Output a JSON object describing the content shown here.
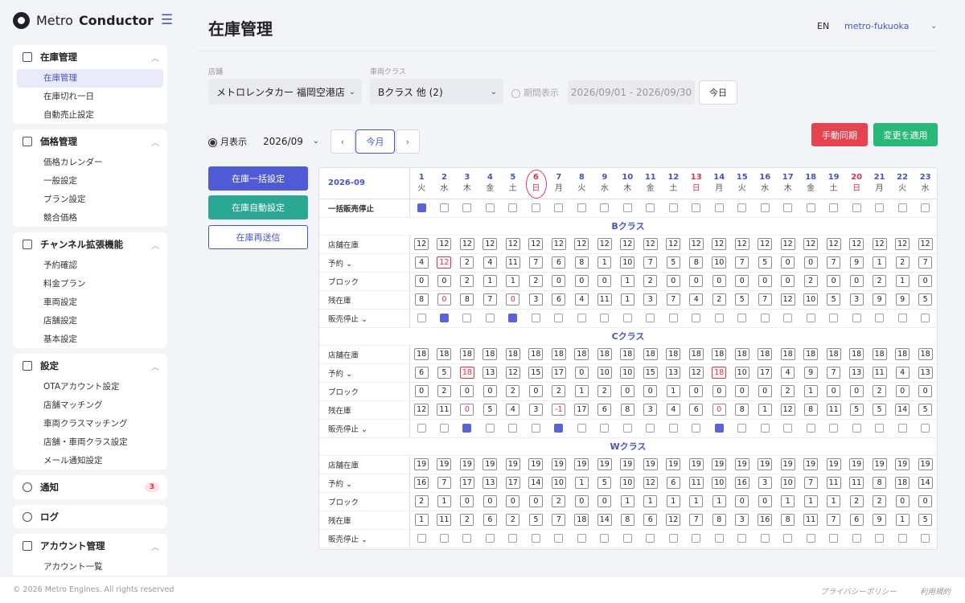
{
  "app": {
    "brand_a": "Metro",
    "brand_b": "Conductor"
  },
  "sidebar": {
    "sections": [
      {
        "title": "在庫管理",
        "items": [
          "在庫管理",
          "在庫切れ一日",
          "自動売止設定"
        ]
      },
      {
        "title": "価格管理",
        "items": [
          "価格カレンダー",
          "一般設定",
          "プラン設定",
          "競合価格"
        ]
      },
      {
        "title": "チャンネル拡張機能",
        "items": [
          "予約確認",
          "料金プラン",
          "車両設定",
          "店舗設定",
          "基本設定"
        ]
      },
      {
        "title": "設定",
        "items": [
          "OTAアカウント設定",
          "店舗マッチング",
          "車両クラスマッチング",
          "店舗・車両クラス設定",
          "メール通知設定"
        ]
      },
      {
        "title": "アカウント管理",
        "items": [
          "アカウント一覧"
        ]
      }
    ],
    "notice": {
      "title": "通知",
      "badge": "3"
    },
    "log": {
      "title": "ログ"
    }
  },
  "header": {
    "title": "在庫管理",
    "lang": "EN",
    "user": "metro-fukuoka"
  },
  "filters": {
    "store_label": "店舗",
    "store_value": "メトロレンタカー 福岡空港店",
    "class_label": "車両クラス",
    "class_value": "Bクラス 他 (2)",
    "period_label": "期間表示",
    "date_range": "2026/09/01 - 2026/09/30",
    "today_btn": "今日"
  },
  "view": {
    "monthly_label": "月表示",
    "month_value": "2026/09",
    "prev": "‹",
    "this_month": "今月",
    "next": "›"
  },
  "actions": {
    "manual_sync": "手動同期",
    "apply_changes": "変更を適用",
    "bulk_set": "在庫一括設定",
    "auto_set": "在庫自動設定",
    "resend": "在庫再送信"
  },
  "grid": {
    "month": "2026-09",
    "days": [
      {
        "d": "1",
        "w": "火"
      },
      {
        "d": "2",
        "w": "水"
      },
      {
        "d": "3",
        "w": "木"
      },
      {
        "d": "4",
        "w": "金"
      },
      {
        "d": "5",
        "w": "土"
      },
      {
        "d": "6",
        "w": "日",
        "sun": true,
        "today": true
      },
      {
        "d": "7",
        "w": "月"
      },
      {
        "d": "8",
        "w": "火"
      },
      {
        "d": "9",
        "w": "水"
      },
      {
        "d": "10",
        "w": "木"
      },
      {
        "d": "11",
        "w": "金"
      },
      {
        "d": "12",
        "w": "土"
      },
      {
        "d": "13",
        "w": "日",
        "sun": true
      },
      {
        "d": "14",
        "w": "月"
      },
      {
        "d": "15",
        "w": "火"
      },
      {
        "d": "16",
        "w": "水"
      },
      {
        "d": "17",
        "w": "木"
      },
      {
        "d": "18",
        "w": "金"
      },
      {
        "d": "19",
        "w": "土"
      },
      {
        "d": "20",
        "w": "日",
        "sun": true
      },
      {
        "d": "21",
        "w": "月"
      },
      {
        "d": "22",
        "w": "火"
      },
      {
        "d": "23",
        "w": "水"
      }
    ],
    "bulk_stop_label": "一括販売停止",
    "bulk_stop": [
      1,
      0,
      0,
      0,
      0,
      0,
      0,
      0,
      0,
      0,
      0,
      0,
      0,
      0,
      0,
      0,
      0,
      0,
      0,
      0,
      0,
      0,
      0
    ],
    "row_labels": {
      "store": "店舗在庫",
      "reserve": "予約 ⌄",
      "block": "ブロック",
      "remain": "残在庫",
      "stop": "販売停止 ⌄"
    },
    "classes": [
      {
        "name": "Bクラス",
        "store": [
          12,
          12,
          12,
          12,
          12,
          12,
          12,
          12,
          12,
          12,
          12,
          12,
          12,
          12,
          12,
          12,
          12,
          12,
          12,
          12,
          12,
          12,
          12
        ],
        "reserve": [
          4,
          12,
          2,
          4,
          11,
          7,
          6,
          8,
          1,
          10,
          7,
          5,
          8,
          10,
          7,
          5,
          0,
          0,
          7,
          9,
          1,
          2,
          7
        ],
        "reserve_flag": [
          1
        ],
        "block": [
          0,
          0,
          2,
          1,
          1,
          2,
          0,
          0,
          0,
          1,
          2,
          0,
          0,
          0,
          0,
          0,
          0,
          2,
          0,
          0,
          2,
          1,
          0
        ],
        "remain": [
          8,
          0,
          8,
          7,
          0,
          3,
          6,
          4,
          11,
          1,
          3,
          7,
          4,
          2,
          5,
          7,
          12,
          10,
          5,
          3,
          9,
          9,
          5
        ],
        "stop": [
          0,
          1,
          0,
          0,
          1,
          0,
          0,
          0,
          0,
          0,
          0,
          0,
          0,
          0,
          0,
          0,
          0,
          0,
          0,
          0,
          0,
          0,
          0
        ]
      },
      {
        "name": "Cクラス",
        "store": [
          18,
          18,
          18,
          18,
          18,
          18,
          18,
          18,
          18,
          18,
          18,
          18,
          18,
          18,
          18,
          18,
          18,
          18,
          18,
          18,
          18,
          18,
          18
        ],
        "reserve": [
          6,
          5,
          18,
          13,
          12,
          15,
          17,
          0,
          10,
          10,
          15,
          13,
          12,
          18,
          10,
          17,
          4,
          9,
          7,
          13,
          11,
          4,
          13
        ],
        "reserve_flag": [
          2,
          13
        ],
        "block": [
          0,
          2,
          0,
          0,
          2,
          0,
          2,
          1,
          2,
          0,
          0,
          1,
          0,
          0,
          0,
          0,
          2,
          1,
          0,
          0,
          2,
          0,
          0
        ],
        "remain": [
          12,
          11,
          0,
          5,
          4,
          3,
          -1,
          17,
          6,
          8,
          3,
          4,
          6,
          0,
          8,
          1,
          12,
          8,
          11,
          5,
          5,
          14,
          5
        ],
        "stop": [
          0,
          0,
          1,
          0,
          0,
          0,
          1,
          0,
          0,
          0,
          0,
          0,
          0,
          1,
          0,
          0,
          0,
          0,
          0,
          0,
          0,
          0,
          0
        ]
      },
      {
        "name": "Wクラス",
        "store": [
          19,
          19,
          19,
          19,
          19,
          19,
          19,
          19,
          19,
          19,
          19,
          19,
          19,
          19,
          19,
          19,
          19,
          19,
          19,
          19,
          19,
          19,
          19
        ],
        "reserve": [
          16,
          7,
          17,
          13,
          17,
          14,
          10,
          1,
          5,
          10,
          12,
          6,
          11,
          10,
          16,
          3,
          10,
          7,
          11,
          11,
          8,
          18,
          14
        ],
        "reserve_flag": [],
        "block": [
          2,
          1,
          0,
          0,
          0,
          0,
          2,
          0,
          0,
          1,
          1,
          1,
          1,
          1,
          0,
          0,
          1,
          1,
          1,
          2,
          2,
          0,
          0
        ],
        "remain": [
          1,
          11,
          2,
          6,
          2,
          5,
          7,
          18,
          14,
          8,
          6,
          12,
          7,
          8,
          3,
          16,
          8,
          11,
          7,
          6,
          9,
          1,
          5
        ],
        "stop": [
          0,
          0,
          0,
          0,
          0,
          0,
          0,
          0,
          0,
          0,
          0,
          0,
          0,
          0,
          0,
          0,
          0,
          0,
          0,
          0,
          0,
          0,
          0
        ]
      }
    ]
  },
  "footer": {
    "copyright": "© 2026 Metro Engines. All rights reserved",
    "privacy": "プライバシーポリシー",
    "terms": "利用規約"
  },
  "colors": {
    "accent": "#4854c4",
    "danger": "#e5434f",
    "success": "#28b87a",
    "teal": "#2aa893"
  }
}
